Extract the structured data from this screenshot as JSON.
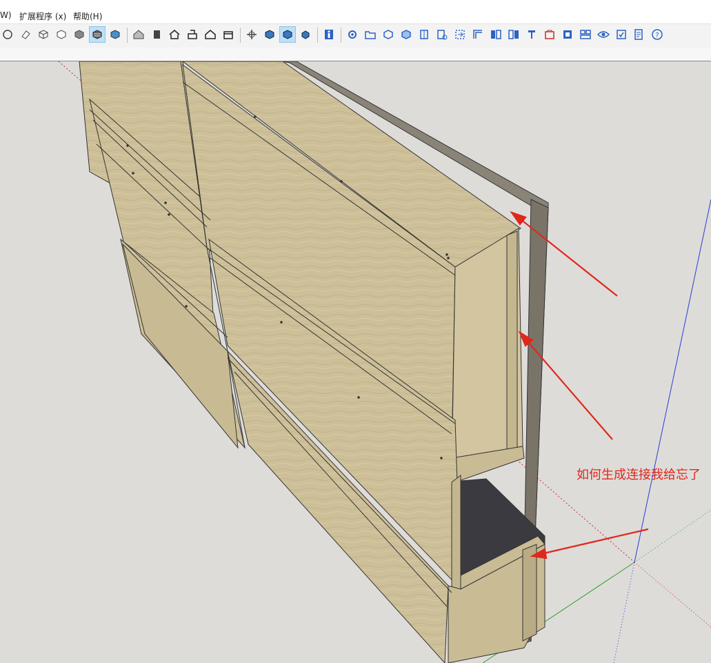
{
  "menubar": {
    "items": [
      "W)",
      "扩展程序 (x)",
      "帮助(H)"
    ]
  },
  "toolbar": {
    "groups": [
      [
        "circle-icon",
        "eraser-icon",
        "cube-wire-icon",
        "cube-outline-icon",
        "cube-shaded-icon",
        "cube-textured-icon",
        "cube-mono-icon"
      ],
      [
        "house-iso-icon",
        "house-front-icon",
        "house-top-icon",
        "house-right-icon",
        "house-back-icon",
        "house-left-icon"
      ],
      [
        "section-icon",
        "box-blue-icon",
        "box-selected-icon",
        "box-small-icon"
      ],
      [
        "info-icon"
      ],
      [
        "gear-icon",
        "folder-icon",
        "component-icon",
        "component-move-icon",
        "door-icon",
        "panel-icon",
        "export-icon",
        "frame-icon",
        "columns-icon",
        "columns-alt-icon",
        "tool-icon",
        "toolbox-red-icon",
        "square-icon",
        "grid-icon",
        "eye-icon",
        "check-icon",
        "report-icon",
        "help-icon"
      ]
    ],
    "selected": [
      "cube-textured-icon",
      "box-selected-icon"
    ]
  },
  "annotation": {
    "text": "如何生成连接我给忘了",
    "color": "#e0271b"
  },
  "colors": {
    "wood": "#cdbf98",
    "wood_dark": "#a69a76",
    "ground": "#dddcd9",
    "axis_red": "#cc2a2a",
    "axis_green": "#2aa02a",
    "axis_blue": "#2a3ad8"
  }
}
